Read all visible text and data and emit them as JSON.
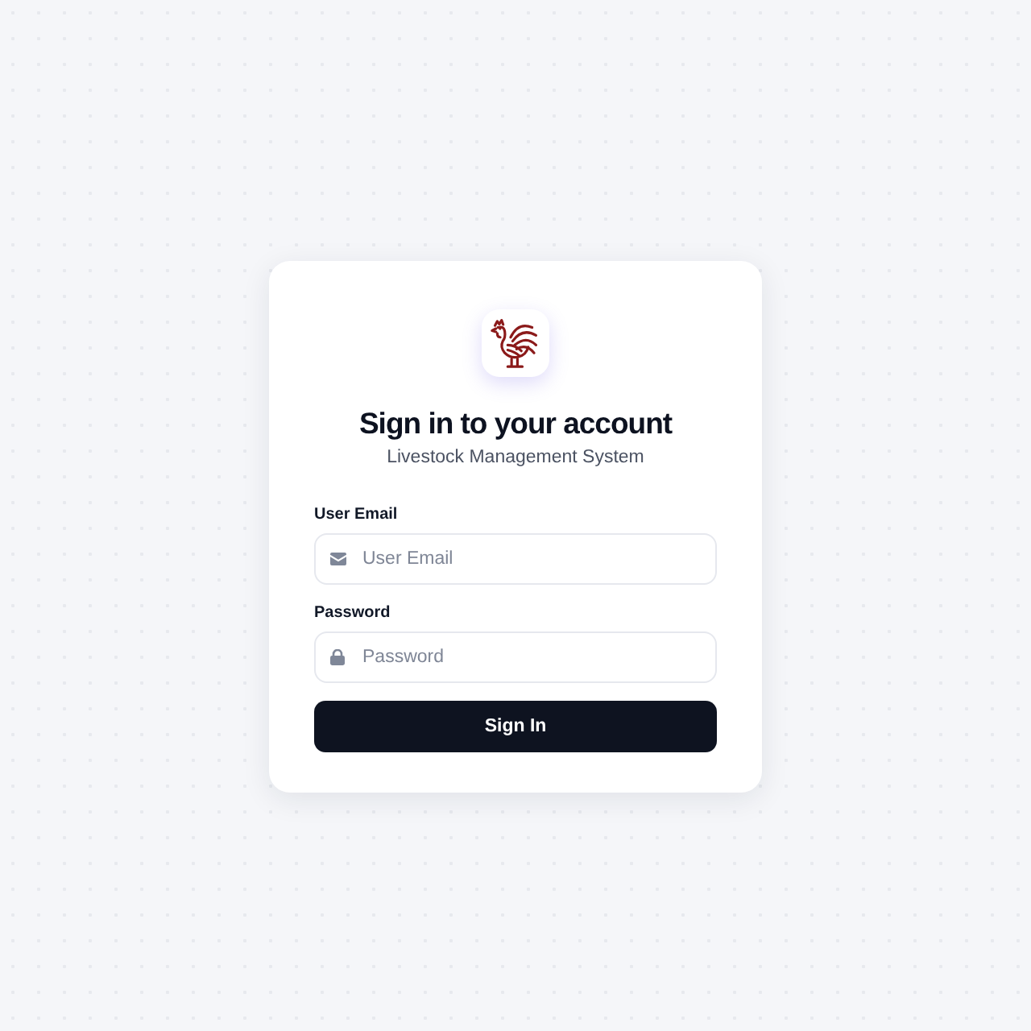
{
  "title": "Sign in to your account",
  "subtitle": "Livestock Management System",
  "fields": [
    {
      "kind": "email",
      "label": "User Email",
      "placeholder": "User Email"
    },
    {
      "kind": "password",
      "label": "Password",
      "placeholder": "Password"
    }
  ],
  "submit_button": "Sign In"
}
